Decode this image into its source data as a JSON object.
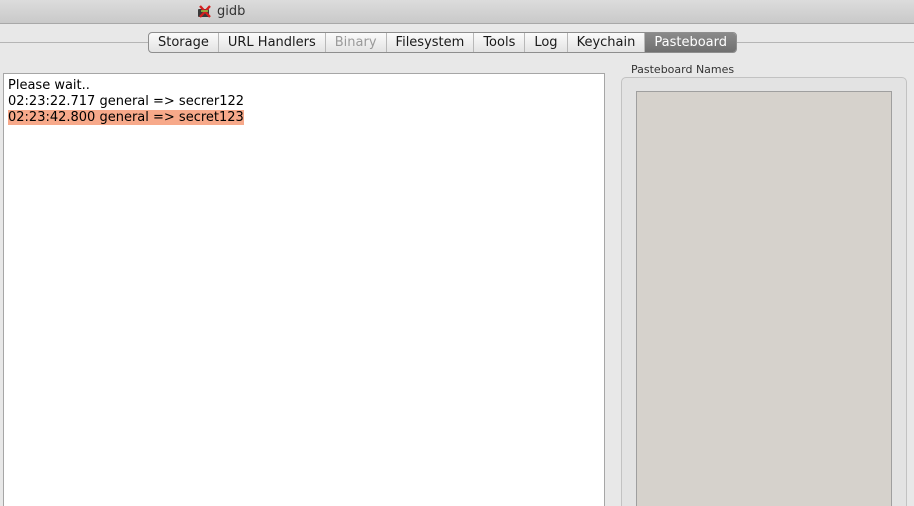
{
  "window": {
    "title": "gidb",
    "app_icon": "gidb-app-icon"
  },
  "tabs": [
    {
      "label": "Storage",
      "state": "normal"
    },
    {
      "label": "URL Handlers",
      "state": "normal"
    },
    {
      "label": "Binary",
      "state": "disabled"
    },
    {
      "label": "Filesystem",
      "state": "normal"
    },
    {
      "label": "Tools",
      "state": "normal"
    },
    {
      "label": "Log",
      "state": "normal"
    },
    {
      "label": "Keychain",
      "state": "normal"
    },
    {
      "label": "Pasteboard",
      "state": "selected"
    }
  ],
  "log": {
    "lines": [
      {
        "text": "Please wait..",
        "highlighted": false
      },
      {
        "text": "02:23:22.717 general => secrer122",
        "highlighted": false
      },
      {
        "text": "02:23:42.800 general => secret123",
        "highlighted": true
      }
    ],
    "highlight_color": "#f7a98a"
  },
  "pasteboard_panel": {
    "label": "Pasteboard Names",
    "items": []
  },
  "colors": {
    "selected_tab": "#7d7d7d",
    "list_background": "#d6d2cc"
  }
}
